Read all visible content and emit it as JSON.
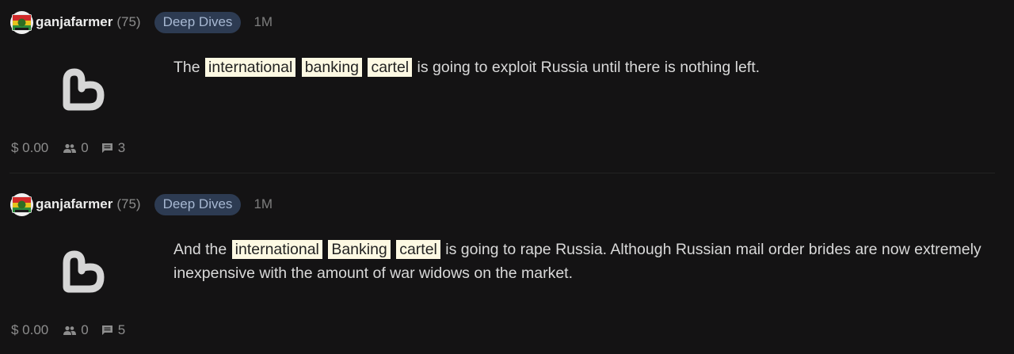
{
  "posts": [
    {
      "author": "ganjafarmer",
      "reputation": "(75)",
      "community": "Deep Dives",
      "time": "1M",
      "body": [
        {
          "t": "The ",
          "hl": false
        },
        {
          "t": "international",
          "hl": true
        },
        {
          "t": " ",
          "hl": false
        },
        {
          "t": "banking",
          "hl": true
        },
        {
          "t": " ",
          "hl": false
        },
        {
          "t": "cartel",
          "hl": true
        },
        {
          "t": " is going to exploit Russia until there is nothing left.",
          "hl": false
        }
      ],
      "payout": "$ 0.00",
      "votes": "0",
      "comments": "3"
    },
    {
      "author": "ganjafarmer",
      "reputation": "(75)",
      "community": "Deep Dives",
      "time": "1M",
      "body": [
        {
          "t": "And the ",
          "hl": false
        },
        {
          "t": "international",
          "hl": true
        },
        {
          "t": " ",
          "hl": false
        },
        {
          "t": "Banking",
          "hl": true
        },
        {
          "t": " ",
          "hl": false
        },
        {
          "t": "cartel",
          "hl": true
        },
        {
          "t": " is going to rape Russia. Although Russian mail order brides are now extremely inexpensive with the amount of war widows on the market.",
          "hl": false
        }
      ],
      "payout": "$ 0.00",
      "votes": "0",
      "comments": "5"
    }
  ],
  "icons": {
    "avatar": "avatar-icon",
    "logo": "blurt-logo-icon",
    "votes": "people-icon",
    "comments": "comment-icon"
  },
  "colors": {
    "background": "#141314",
    "tag_bg": "#2d3b52",
    "tag_text": "#a7b8d2",
    "highlight": "#fdf9e3"
  }
}
